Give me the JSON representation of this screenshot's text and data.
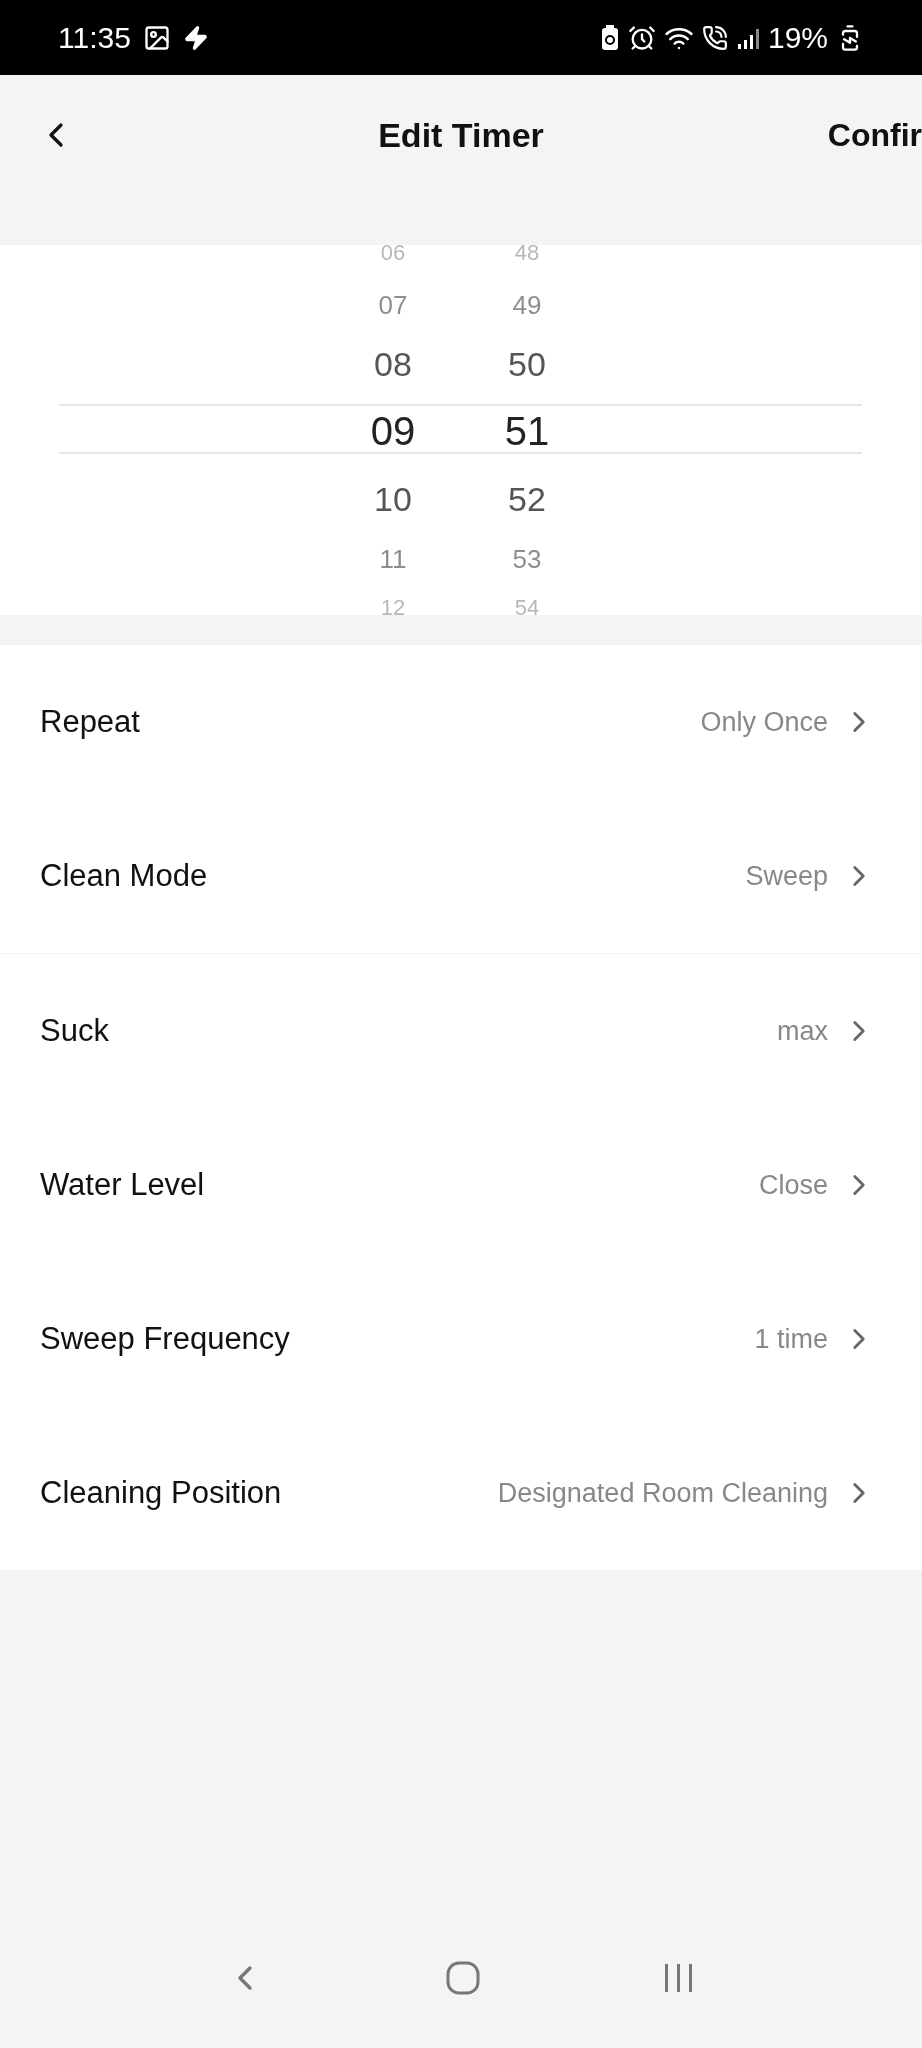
{
  "status_bar": {
    "time": "11:35",
    "battery": "19%"
  },
  "header": {
    "title": "Edit Timer",
    "action": "Confir"
  },
  "picker": {
    "hours": [
      {
        "label": "06",
        "selected": false
      },
      {
        "label": "07",
        "selected": false
      },
      {
        "label": "08",
        "selected": false
      },
      {
        "label": "09",
        "selected": true
      },
      {
        "label": "10",
        "selected": false
      },
      {
        "label": "11",
        "selected": false
      },
      {
        "label": "12",
        "selected": false
      }
    ],
    "minutes": [
      {
        "label": "48",
        "selected": false
      },
      {
        "label": "49",
        "selected": false
      },
      {
        "label": "50",
        "selected": false
      },
      {
        "label": "51",
        "selected": true
      },
      {
        "label": "52",
        "selected": false
      },
      {
        "label": "53",
        "selected": false
      },
      {
        "label": "54",
        "selected": false
      }
    ]
  },
  "settings": [
    {
      "label": "Repeat",
      "value": "Only Once"
    },
    {
      "label": "Clean Mode",
      "value": "Sweep"
    },
    {
      "label": "Suck",
      "value": "max"
    },
    {
      "label": "Water Level",
      "value": "Close"
    },
    {
      "label": "Sweep Frequency",
      "value": "1 time"
    },
    {
      "label": "Cleaning Position",
      "value": "Designated Room Cleaning"
    }
  ]
}
